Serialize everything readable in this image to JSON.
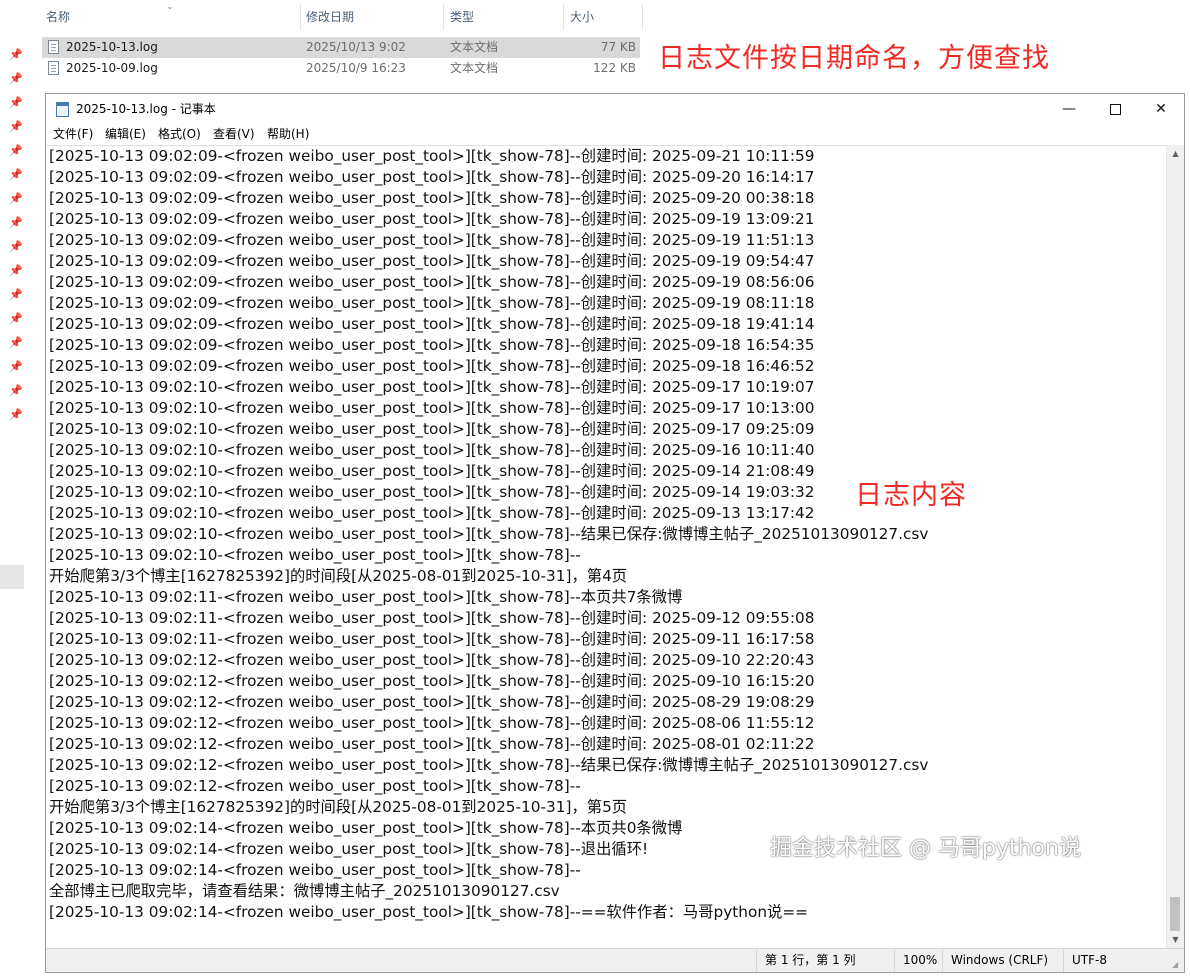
{
  "explorer": {
    "columns": [
      "名称",
      "修改日期",
      "类型",
      "大小"
    ],
    "files": [
      {
        "name": "2025-10-13.log",
        "date": "2025/10/13 9:02",
        "type": "文本文档",
        "size": "77 KB"
      },
      {
        "name": "2025-10-09.log",
        "date": "2025/10/9 16:23",
        "type": "文本文档",
        "size": "122 KB"
      }
    ]
  },
  "annotations": {
    "file_naming": "日志文件按日期命名，方便查找",
    "log_content": "日志内容"
  },
  "notepad": {
    "title": "2025-10-13.log - 记事本",
    "controls": {
      "minimize": "—",
      "close": "✕"
    },
    "menu": [
      "文件(F)",
      "编辑(E)",
      "格式(O)",
      "查看(V)",
      "帮助(H)"
    ],
    "lines": [
      "[2025-10-13 09:02:09-<frozen weibo_user_post_tool>][tk_show-78]--创建时间: 2025-09-21 10:11:59",
      "[2025-10-13 09:02:09-<frozen weibo_user_post_tool>][tk_show-78]--创建时间: 2025-09-20 16:14:17",
      "[2025-10-13 09:02:09-<frozen weibo_user_post_tool>][tk_show-78]--创建时间: 2025-09-20 00:38:18",
      "[2025-10-13 09:02:09-<frozen weibo_user_post_tool>][tk_show-78]--创建时间: 2025-09-19 13:09:21",
      "[2025-10-13 09:02:09-<frozen weibo_user_post_tool>][tk_show-78]--创建时间: 2025-09-19 11:51:13",
      "[2025-10-13 09:02:09-<frozen weibo_user_post_tool>][tk_show-78]--创建时间: 2025-09-19 09:54:47",
      "[2025-10-13 09:02:09-<frozen weibo_user_post_tool>][tk_show-78]--创建时间: 2025-09-19 08:56:06",
      "[2025-10-13 09:02:09-<frozen weibo_user_post_tool>][tk_show-78]--创建时间: 2025-09-19 08:11:18",
      "[2025-10-13 09:02:09-<frozen weibo_user_post_tool>][tk_show-78]--创建时间: 2025-09-18 19:41:14",
      "[2025-10-13 09:02:09-<frozen weibo_user_post_tool>][tk_show-78]--创建时间: 2025-09-18 16:54:35",
      "[2025-10-13 09:02:09-<frozen weibo_user_post_tool>][tk_show-78]--创建时间: 2025-09-18 16:46:52",
      "[2025-10-13 09:02:10-<frozen weibo_user_post_tool>][tk_show-78]--创建时间: 2025-09-17 10:19:07",
      "[2025-10-13 09:02:10-<frozen weibo_user_post_tool>][tk_show-78]--创建时间: 2025-09-17 10:13:00",
      "[2025-10-13 09:02:10-<frozen weibo_user_post_tool>][tk_show-78]--创建时间: 2025-09-17 09:25:09",
      "[2025-10-13 09:02:10-<frozen weibo_user_post_tool>][tk_show-78]--创建时间: 2025-09-16 10:11:40",
      "[2025-10-13 09:02:10-<frozen weibo_user_post_tool>][tk_show-78]--创建时间: 2025-09-14 21:08:49",
      "[2025-10-13 09:02:10-<frozen weibo_user_post_tool>][tk_show-78]--创建时间: 2025-09-14 19:03:32",
      "[2025-10-13 09:02:10-<frozen weibo_user_post_tool>][tk_show-78]--创建时间: 2025-09-13 13:17:42",
      "[2025-10-13 09:02:10-<frozen weibo_user_post_tool>][tk_show-78]--结果已保存:微博博主帖子_20251013090127.csv",
      "[2025-10-13 09:02:10-<frozen weibo_user_post_tool>][tk_show-78]--",
      "开始爬第3/3个博主[1627825392]的时间段[从2025-08-01到2025-10-31]，第4页",
      "[2025-10-13 09:02:11-<frozen weibo_user_post_tool>][tk_show-78]--本页共7条微博",
      "[2025-10-13 09:02:11-<frozen weibo_user_post_tool>][tk_show-78]--创建时间: 2025-09-12 09:55:08",
      "[2025-10-13 09:02:11-<frozen weibo_user_post_tool>][tk_show-78]--创建时间: 2025-09-11 16:17:58",
      "[2025-10-13 09:02:12-<frozen weibo_user_post_tool>][tk_show-78]--创建时间: 2025-09-10 22:20:43",
      "[2025-10-13 09:02:12-<frozen weibo_user_post_tool>][tk_show-78]--创建时间: 2025-09-10 16:15:20",
      "[2025-10-13 09:02:12-<frozen weibo_user_post_tool>][tk_show-78]--创建时间: 2025-08-29 19:08:29",
      "[2025-10-13 09:02:12-<frozen weibo_user_post_tool>][tk_show-78]--创建时间: 2025-08-06 11:55:12",
      "[2025-10-13 09:02:12-<frozen weibo_user_post_tool>][tk_show-78]--创建时间: 2025-08-01 02:11:22",
      "[2025-10-13 09:02:12-<frozen weibo_user_post_tool>][tk_show-78]--结果已保存:微博博主帖子_20251013090127.csv",
      "[2025-10-13 09:02:12-<frozen weibo_user_post_tool>][tk_show-78]--",
      "开始爬第3/3个博主[1627825392]的时间段[从2025-08-01到2025-10-31]，第5页",
      "[2025-10-13 09:02:14-<frozen weibo_user_post_tool>][tk_show-78]--本页共0条微博",
      "[2025-10-13 09:02:14-<frozen weibo_user_post_tool>][tk_show-78]--退出循环!",
      "[2025-10-13 09:02:14-<frozen weibo_user_post_tool>][tk_show-78]--",
      "全部博主已爬取完毕，请查看结果：微博博主帖子_20251013090127.csv",
      "[2025-10-13 09:02:14-<frozen weibo_user_post_tool>][tk_show-78]--==软件作者：马哥python说=="
    ],
    "status": {
      "position": "第 1 行，第 1 列",
      "zoom": "100%",
      "line_ending": "Windows (CRLF)",
      "encoding": "UTF-8"
    }
  },
  "watermark": "掘金技术社区 @ 马哥python说",
  "colors": {
    "annotation": "#f02a24",
    "selected_row": "#d9d9d9"
  }
}
